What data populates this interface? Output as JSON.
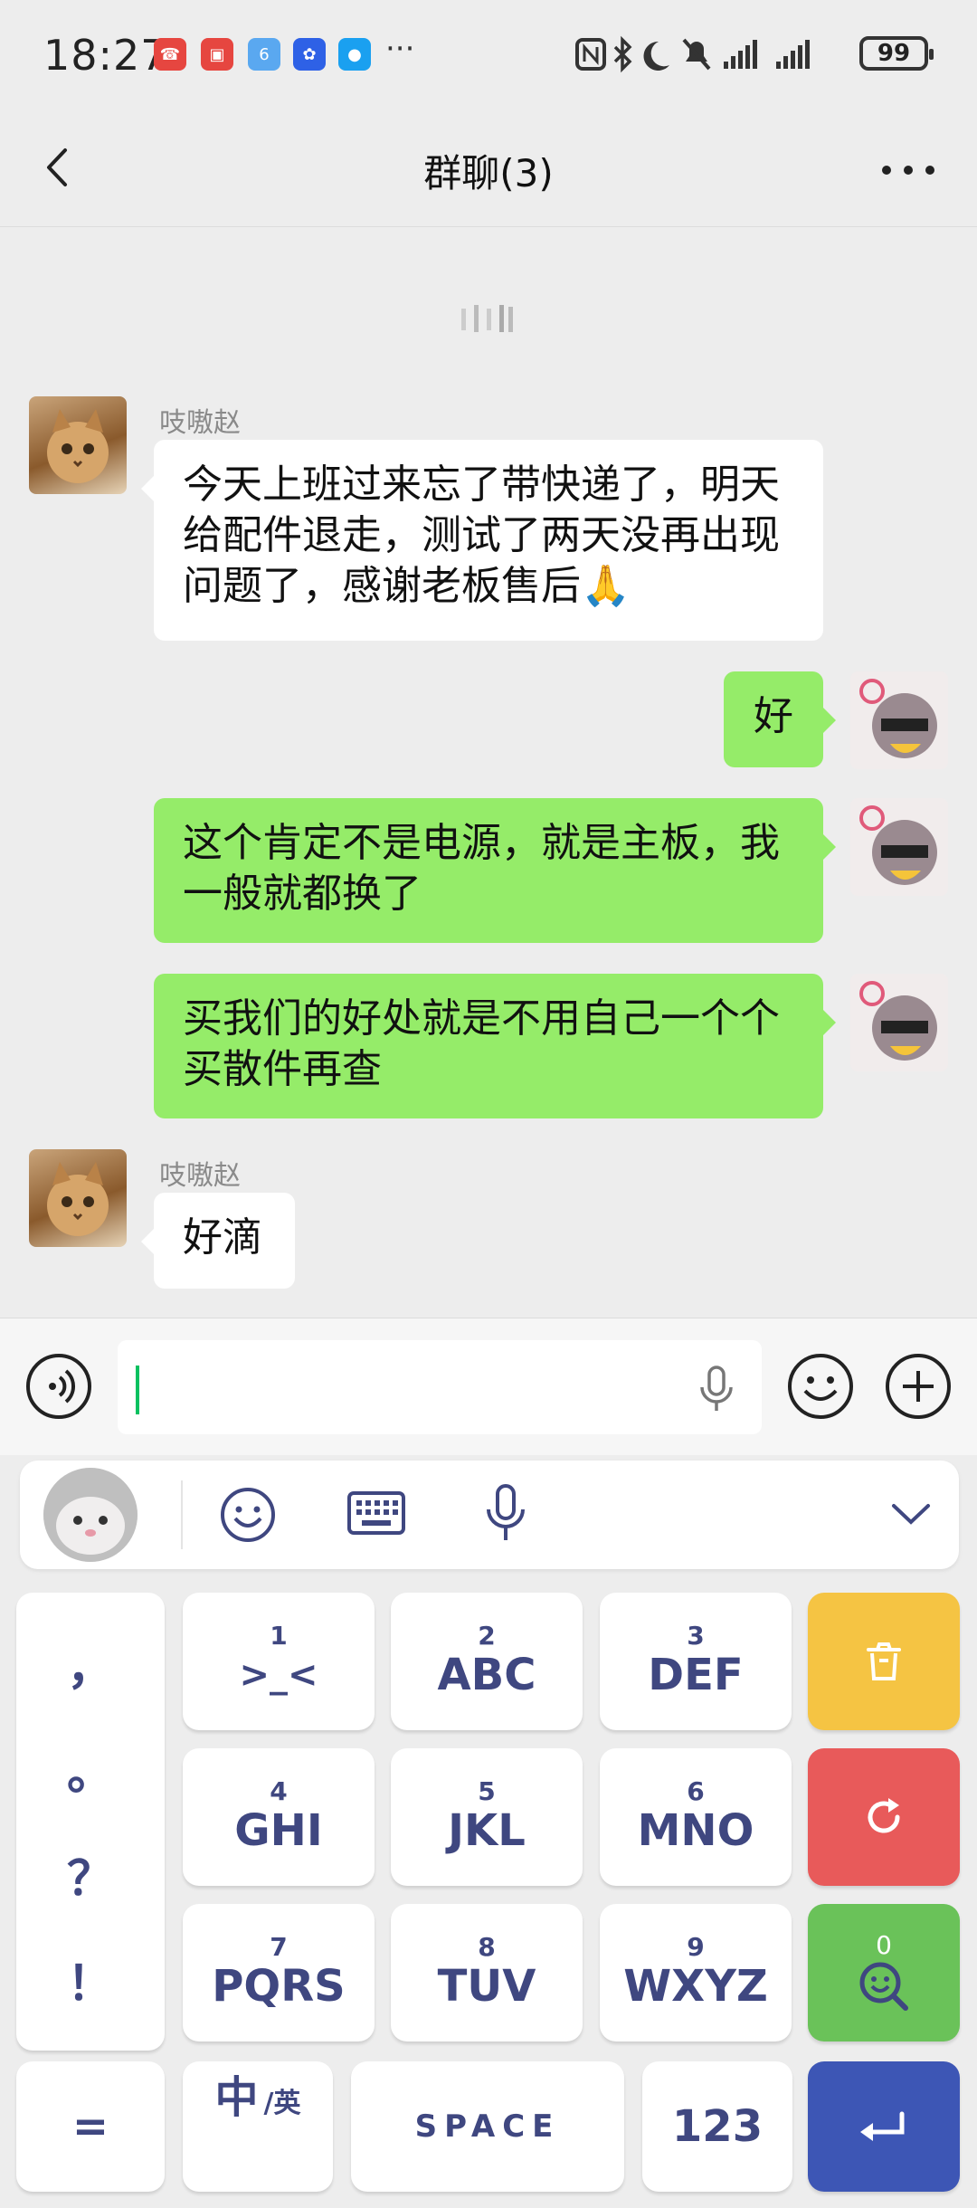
{
  "status": {
    "time": "18:27",
    "dots": "···",
    "battery": "99"
  },
  "header": {
    "title": "群聊(3)"
  },
  "messages": [
    {
      "side": "left",
      "sender": "吱嗷赵",
      "text_lines": [
        "今天上班过来忘了带快递了，明天",
        "给配件退走，测试了两天没再出现",
        "问题了，感谢老板售后🙏"
      ]
    },
    {
      "side": "right",
      "text_lines": [
        "好"
      ]
    },
    {
      "side": "right",
      "text_lines": [
        "这个肯定不是电源，就是主板，我",
        "一般就都换了"
      ]
    },
    {
      "side": "right",
      "text_lines": [
        "买我们的好处就是不用自己一个个",
        "买散件再查"
      ]
    },
    {
      "side": "left",
      "sender": "吱嗷赵",
      "text_lines": [
        "好滴"
      ]
    }
  ],
  "keyboard": {
    "rows": [
      [
        {
          "num": "1",
          "letters": ">_<"
        },
        {
          "num": "2",
          "letters": "ABC"
        },
        {
          "num": "3",
          "letters": "DEF"
        }
      ],
      [
        {
          "num": "4",
          "letters": "GHI"
        },
        {
          "num": "5",
          "letters": "JKL"
        },
        {
          "num": "6",
          "letters": "MNO"
        }
      ],
      [
        {
          "num": "7",
          "letters": "PQRS"
        },
        {
          "num": "8",
          "letters": "TUV"
        },
        {
          "num": "9",
          "letters": "WXYZ"
        }
      ]
    ],
    "punctuation": [
      "，",
      "。",
      "？",
      "！"
    ],
    "equals": "=",
    "lang_main": "中",
    "lang_alt": "/英",
    "space": "SPACE",
    "num_key": "123",
    "search_count": "0",
    "colors": {
      "delete": "#f5c443",
      "reload": "#e85a5a",
      "search": "#6ac259",
      "enter": "#3d56b5",
      "key_text": "#3f4780"
    }
  }
}
